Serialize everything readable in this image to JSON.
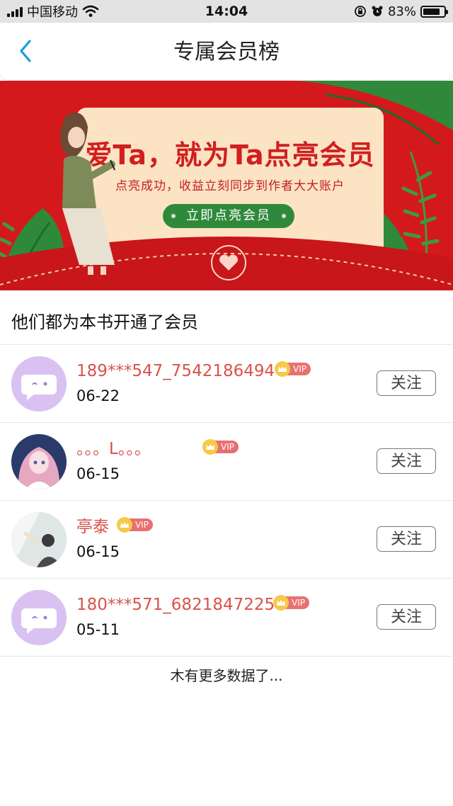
{
  "status_bar": {
    "carrier": "中国移动",
    "time": "14:04",
    "battery": "83%",
    "battery_level": 0.83,
    "icons": [
      "signal-icon",
      "wifi-icon",
      "orientation-lock-icon",
      "alarm-icon",
      "battery-icon"
    ]
  },
  "nav": {
    "back_icon": "chevron-left-icon",
    "title": "专属会员榜"
  },
  "banner": {
    "headline": "爱Ta，就为Ta点亮会员",
    "subline": "点亮成功，收益立刻同步到作者大大账户",
    "cta": "立即点亮会员"
  },
  "section": {
    "title": "他们都为本书开通了会员"
  },
  "members": [
    {
      "name": "189***547_7542186494",
      "badge": "VIP",
      "date": "06-22",
      "follow": "关注",
      "avatar": "default-chat-avatar"
    },
    {
      "name": "。。。L。。。",
      "badge": "VIP",
      "date": "06-15",
      "follow": "关注",
      "avatar": "anime-girl-avatar"
    },
    {
      "name": "亭泰",
      "badge": "VIP",
      "date": "06-15",
      "follow": "关注",
      "avatar": "photo-avatar"
    },
    {
      "name": "180***571_6821847225",
      "badge": "VIP",
      "date": "05-11",
      "follow": "关注",
      "avatar": "default-chat-avatar"
    }
  ],
  "footer": {
    "note": "木有更多数据了..."
  },
  "colors": {
    "accent": "#1a9de0",
    "banner_red": "#d4191c",
    "name_red": "#d9534a",
    "cta_green": "#2e8a3a",
    "avatar_lilac": "#d9c2f2"
  }
}
